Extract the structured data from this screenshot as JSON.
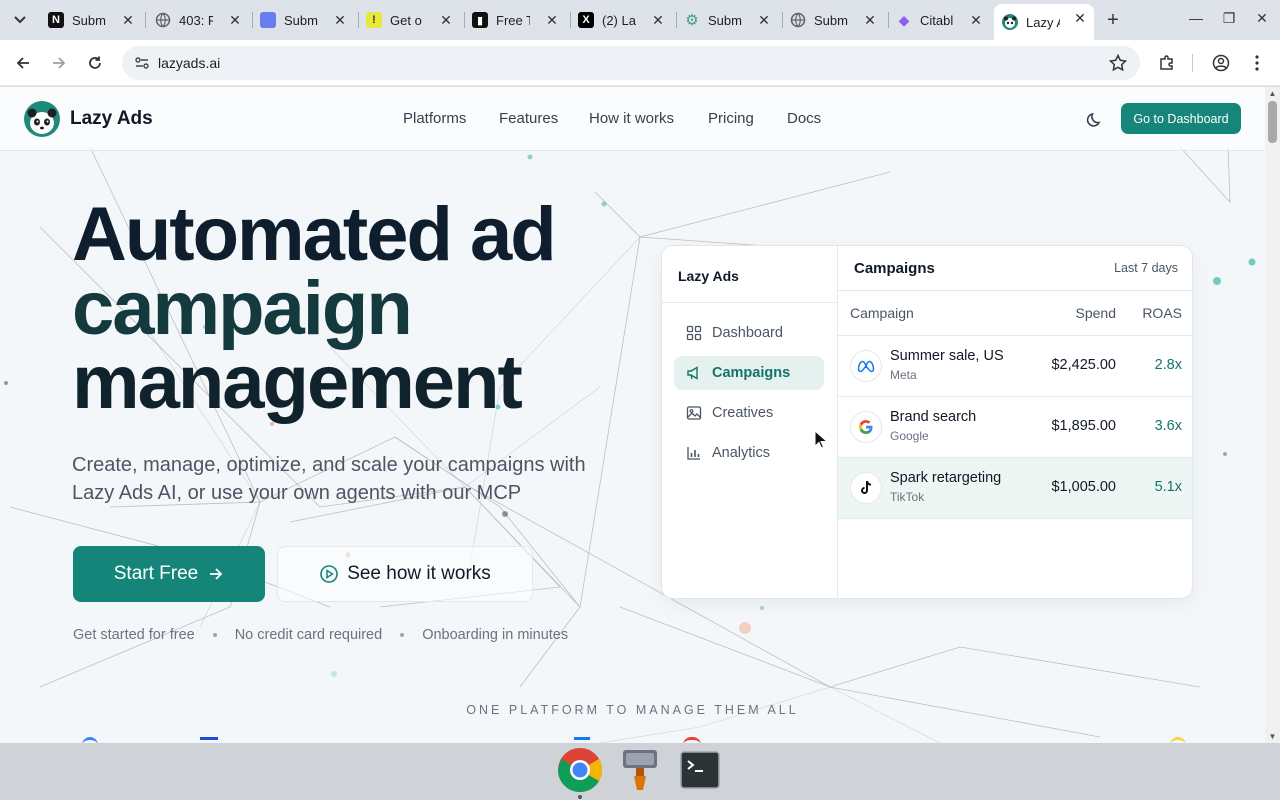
{
  "browser": {
    "tabs": [
      {
        "title": "Subm",
        "favicon": "notion-icon",
        "color": "#111111",
        "glyph": "N"
      },
      {
        "title": "403: F",
        "favicon": "globe-icon",
        "color": "#5f6368",
        "glyph": ""
      },
      {
        "title": "Subm",
        "favicon": "form-icon",
        "color": "#6b7cf0",
        "glyph": ""
      },
      {
        "title": "Get o",
        "favicon": "warning-icon",
        "color": "#e8e83a",
        "glyph": "!"
      },
      {
        "title": "Free T",
        "favicon": "medium-icon",
        "color": "#111111",
        "glyph": "▮"
      },
      {
        "title": "(2) La",
        "favicon": "x-icon",
        "color": "#000000",
        "glyph": "X"
      },
      {
        "title": "Subm",
        "favicon": "gear-icon",
        "color": "#3a9d8c",
        "glyph": "⚙"
      },
      {
        "title": "Subm",
        "favicon": "globe-icon",
        "color": "#5f6368",
        "glyph": ""
      },
      {
        "title": "Citabl",
        "favicon": "diamond-icon",
        "color": "#8b5cf6",
        "glyph": "◆"
      },
      {
        "title": "Lazy A",
        "favicon": "panda-icon",
        "color": "#1f8a7c",
        "glyph": ""
      }
    ],
    "active_tab": 9,
    "url": "lazyads.ai"
  },
  "header": {
    "brand": "Lazy Ads",
    "nav": [
      "Platforms",
      "Features",
      "How it works",
      "Pricing",
      "Docs"
    ],
    "dashboard_button": "Go to Dashboard"
  },
  "hero": {
    "title_line1": "Automated ad",
    "title_line2": "campaign",
    "title_line3": "management",
    "subtitle": "Create, manage, optimize, and scale your campaigns with Lazy Ads AI, or use your own agents with our MCP",
    "cta_primary": "Start Free",
    "cta_secondary": "See how it works",
    "perks": [
      "Get started for free",
      "No credit card required",
      "Onboarding in minutes"
    ],
    "platforms_caption": "ONE PLATFORM TO MANAGE THEM ALL"
  },
  "mock": {
    "brand": "Lazy Ads",
    "nav": [
      {
        "label": "Dashboard",
        "icon": "grid-icon"
      },
      {
        "label": "Campaigns",
        "icon": "megaphone-icon"
      },
      {
        "label": "Creatives",
        "icon": "image-icon"
      },
      {
        "label": "Analytics",
        "icon": "bar-chart-icon"
      }
    ],
    "active_nav": 1,
    "title": "Campaigns",
    "range": "Last 7 days",
    "columns": [
      "Campaign",
      "Spend",
      "ROAS"
    ],
    "rows": [
      {
        "name": "Summer sale, US",
        "platform": "Meta",
        "spend": "$2,425.00",
        "roas": "2.8x",
        "logo": "meta-icon"
      },
      {
        "name": "Brand search",
        "platform": "Google",
        "spend": "$1,895.00",
        "roas": "3.6x",
        "logo": "google-icon"
      },
      {
        "name": "Spark retargeting",
        "platform": "TikTok",
        "spend": "$1,005.00",
        "roas": "5.1x",
        "logo": "tiktok-icon"
      }
    ],
    "highlighted_row": 2
  },
  "colors": {
    "brand": "#16867a",
    "roas": "#14746a"
  },
  "taskbar": [
    "chrome-icon",
    "app-icon",
    "terminal-icon"
  ]
}
